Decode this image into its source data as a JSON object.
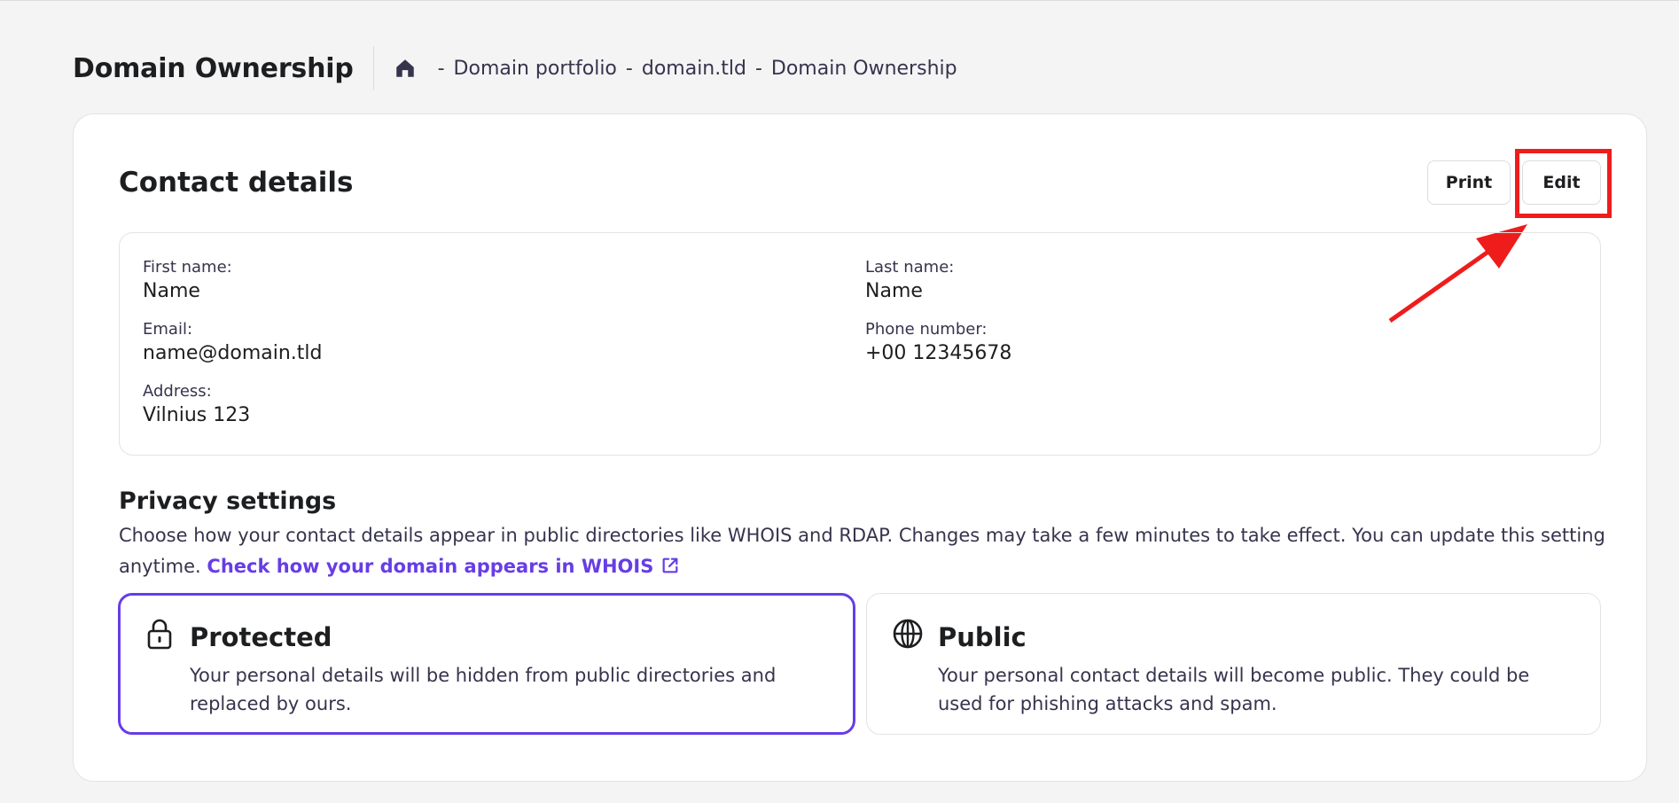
{
  "header": {
    "title": "Domain Ownership",
    "breadcrumb": {
      "home_icon": "home-icon",
      "items": [
        "Domain portfolio",
        "domain.tld",
        "Domain Ownership"
      ],
      "separator": "-"
    }
  },
  "contact": {
    "title": "Contact details",
    "print_label": "Print",
    "edit_label": "Edit",
    "fields": {
      "first_name": {
        "label": "First name:",
        "value": "Name"
      },
      "last_name": {
        "label": "Last name:",
        "value": "Name"
      },
      "email": {
        "label": "Email:",
        "value": "name@domain.tld"
      },
      "phone": {
        "label": "Phone number:",
        "value": "+00 12345678"
      },
      "address": {
        "label": "Address:",
        "value": "Vilnius 123"
      }
    }
  },
  "privacy": {
    "title": "Privacy settings",
    "description": "Choose how your contact details appear in public directories like WHOIS and RDAP. Changes may take a few minutes to take effect. You can update this setting anytime.",
    "link_label": "Check how your domain appears in WHOIS",
    "options": [
      {
        "icon": "lock-icon",
        "title": "Protected",
        "description": "Your personal details will be hidden from public directories and replaced by ours.",
        "selected": true
      },
      {
        "icon": "globe-icon",
        "title": "Public",
        "description": "Your personal contact details will become public. They could be used for phishing attacks and spam.",
        "selected": false
      }
    ]
  },
  "colors": {
    "accent": "#673de6",
    "annotation": "#ef1c1c",
    "background": "#f4f4f5"
  }
}
